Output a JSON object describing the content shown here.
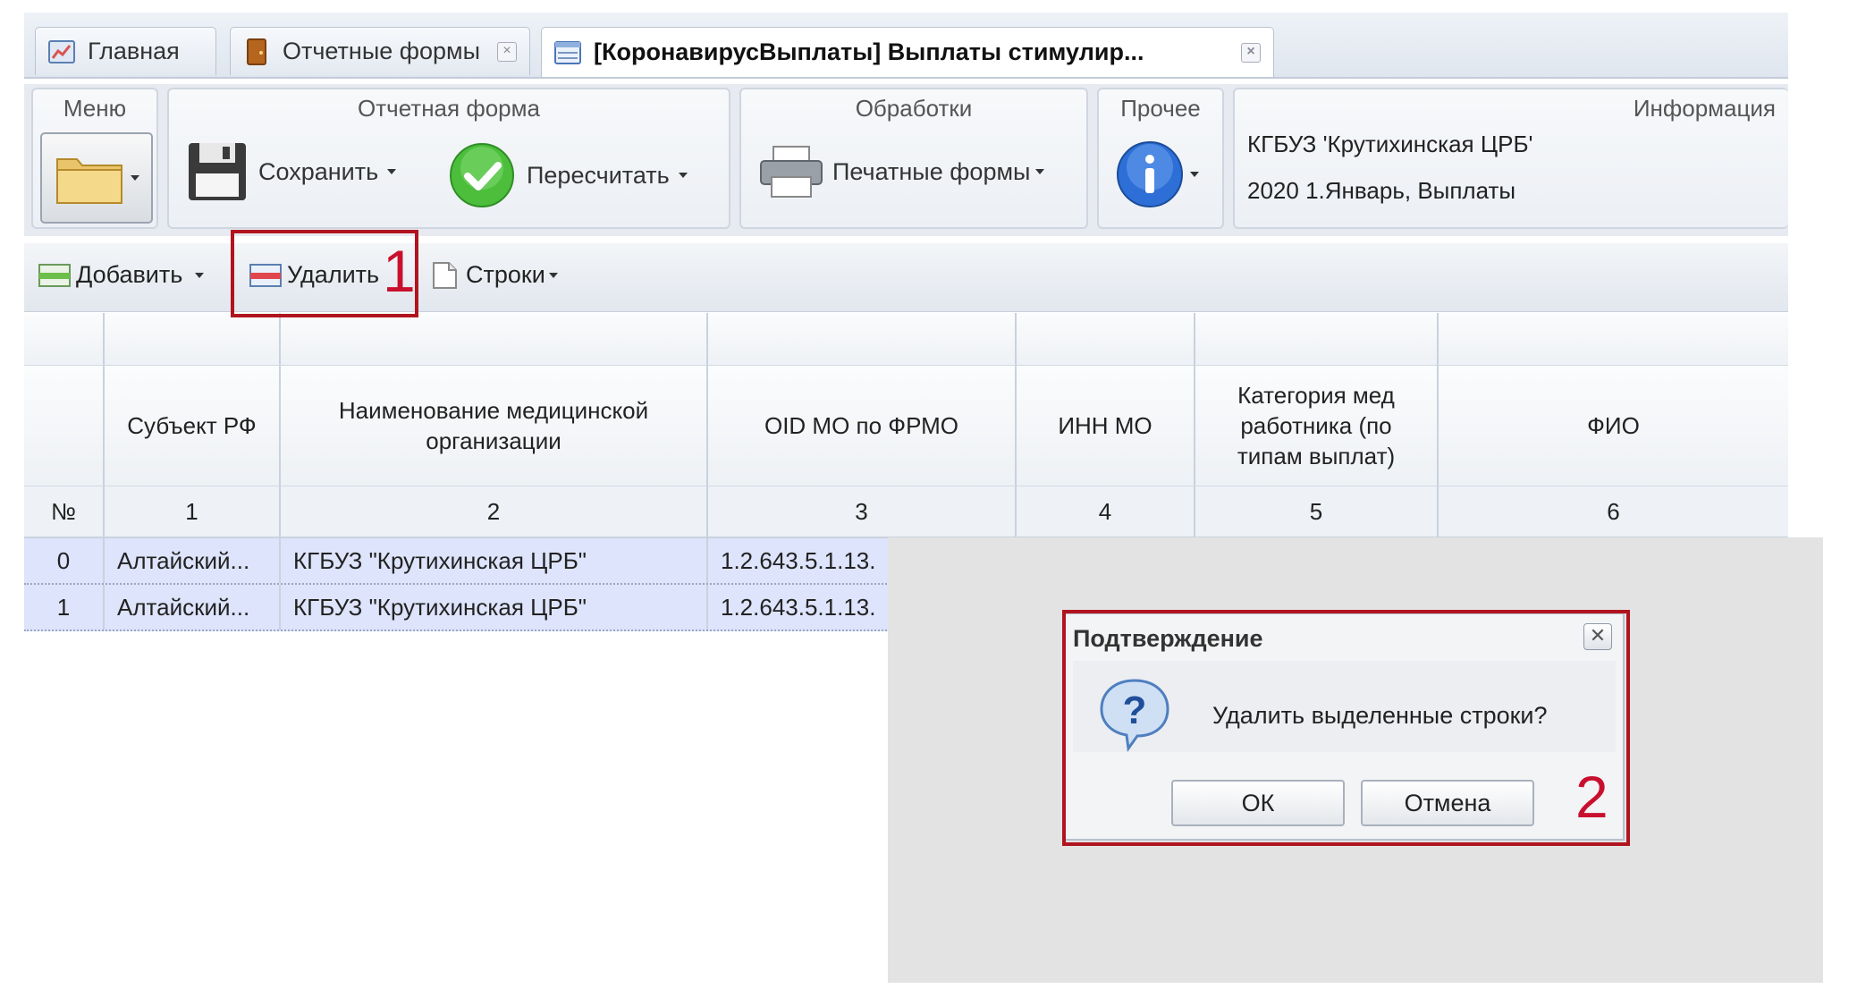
{
  "tabs": [
    {
      "label": "Главная",
      "icon": "home-chart-icon",
      "active": false
    },
    {
      "label": "Отчетные формы",
      "icon": "door-icon",
      "active": false
    },
    {
      "label": "[КоронавирусВыплаты] Выплаты стимулир...",
      "icon": "form-table-icon",
      "active": true
    }
  ],
  "ribbon": {
    "menu": {
      "title": "Меню"
    },
    "report_form": {
      "title": "Отчетная форма",
      "save_label": "Сохранить",
      "recalc_label": "Пересчитать"
    },
    "processing": {
      "title": "Обработки",
      "print_label": "Печатные формы"
    },
    "other": {
      "title": "Прочее"
    },
    "info": {
      "title": "Информация",
      "line1": "КГБУЗ 'Крутихинская ЦРБ'",
      "line2": "2020 1.Январь, Выплаты"
    }
  },
  "toolbar": {
    "add_label": "Добавить",
    "delete_label": "Удалить",
    "rows_label": "Строки"
  },
  "grid": {
    "columns": [
      {
        "header": "",
        "num": "№"
      },
      {
        "header": "Субъект РФ",
        "num": "1"
      },
      {
        "header": "Наименование медицинской организации",
        "num": "2"
      },
      {
        "header": "OID МО по ФРМО",
        "num": "3"
      },
      {
        "header": "ИНН МО",
        "num": "4"
      },
      {
        "header": "Категория мед работника (по типам выплат)",
        "num": "5"
      },
      {
        "header": "ФИО",
        "num": "6"
      }
    ],
    "rows": [
      {
        "n": "0",
        "region": "Алтайский...",
        "org": "КГБУЗ \"Крутихинская ЦРБ\"",
        "oid": "1.2.643.5.1.13."
      },
      {
        "n": "1",
        "region": "Алтайский...",
        "org": "КГБУЗ \"Крутихинская ЦРБ\"",
        "oid": "1.2.643.5.1.13."
      }
    ]
  },
  "dialog": {
    "title": "Подтверждение",
    "message": "Удалить выделенные строки?",
    "ok_label": "ОК",
    "cancel_label": "Отмена",
    "close_glyph": "✕"
  },
  "callouts": {
    "first": "1",
    "second": "2"
  },
  "colors": {
    "accent_red": "#b0141f",
    "selected_row": "#dde4fb"
  }
}
